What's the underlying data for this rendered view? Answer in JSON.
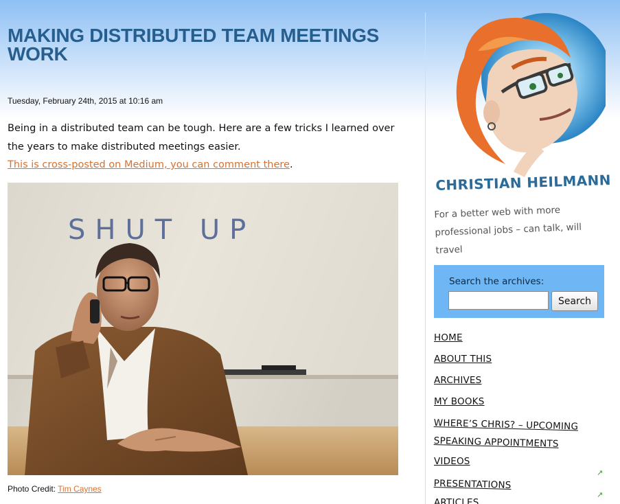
{
  "post": {
    "title": "MAKING DISTRIBUTED TEAM MEETINGS WORK",
    "date": "Tuesday, February 24th, 2015 at 10:16 am",
    "intro": "Being in a distributed team can be tough. Here are a few tricks I learned over the years to make distributed meetings easier.",
    "crosspost_link": "This is cross-posted on Medium, you can comment there",
    "crosspost_suffix": ".",
    "photo_whiteboard_text": "SHUT UP",
    "photo_credit_label": "Photo Credit: ",
    "photo_credit_link": "Tim Caynes"
  },
  "sidebar": {
    "site_title": "CHRISTIAN HEILMANN",
    "tagline": "For a better web with more professional jobs – can talk, will travel",
    "search": {
      "label": "Search the archives:",
      "value": "",
      "button": "Search"
    },
    "nav": [
      {
        "label": "HOME"
      },
      {
        "label": "ABOUT THIS"
      },
      {
        "label": "ARCHIVES"
      },
      {
        "label": "MY BOOKS"
      },
      {
        "label": "WHERE’S CHRIS? – UPCOMING"
      },
      {
        "label": "SPEAKING APPOINTMENTS"
      },
      {
        "label": "VIDEOS"
      },
      {
        "label": "PRESENTATIONS"
      },
      {
        "label": "ARTICLES"
      }
    ]
  },
  "colors": {
    "title": "#265e8e",
    "link": "#d9712c",
    "search_bg": "#6eb6f4",
    "site_title": "#2a6b9a"
  },
  "icons": [
    "external-link-arrow-icon"
  ]
}
